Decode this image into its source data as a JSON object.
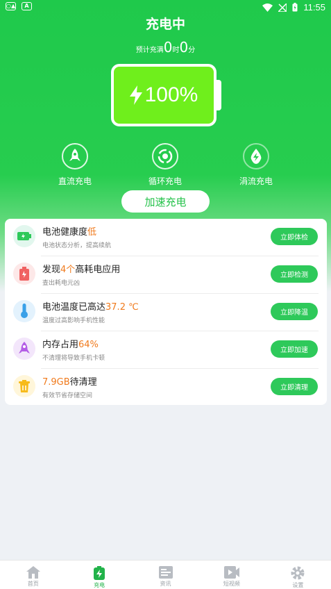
{
  "status_bar": {
    "time": "11:55"
  },
  "header": {
    "title": "充电中",
    "remain_prefix": "预计充满",
    "hours": "0",
    "hours_unit": "时",
    "minutes": "0",
    "minutes_unit": "分"
  },
  "battery": {
    "percent": "100%",
    "level": 1.0
  },
  "modes": [
    {
      "label": "直流充电",
      "icon": "rocket-icon"
    },
    {
      "label": "循环充电",
      "icon": "cycle-icon"
    },
    {
      "label": "涓流充电",
      "icon": "drop-bolt-icon"
    }
  ],
  "boost_label": "加速充电",
  "items": [
    {
      "title_before": "电池健康度",
      "title_highlight": "低",
      "title_after": "",
      "subtitle": "电池状态分析，提高续航",
      "button": "立即体检",
      "icon": "battery-icon",
      "icon_bg": "#e2f7ee",
      "icon_color": "#2ec95a"
    },
    {
      "title_before": "发现",
      "title_highlight": "4个",
      "title_after": "高耗电应用",
      "subtitle": "查出耗电元凶",
      "button": "立即检测",
      "icon": "battery-warning-icon",
      "icon_bg": "#fde8e8",
      "icon_color": "#f06262"
    },
    {
      "title_before": "电池温度已高达",
      "title_highlight": "37.2 ℃",
      "title_after": "",
      "subtitle": "温度过高影响手机性能",
      "button": "立即降温",
      "icon": "thermometer-icon",
      "icon_bg": "#e3f2fd",
      "icon_color": "#3aa0e8"
    },
    {
      "title_before": "内存占用",
      "title_highlight": "64%",
      "title_after": "",
      "subtitle": "不清理将导致手机卡顿",
      "button": "立即加速",
      "icon": "rocket-icon",
      "icon_bg": "#f3e6fb",
      "icon_color": "#b45de6"
    },
    {
      "title_before": "",
      "title_highlight": "7.9GB",
      "title_after": "待清理",
      "subtitle": "有效节省存储空间",
      "button": "立即清理",
      "icon": "trash-icon",
      "icon_bg": "#fff6da",
      "icon_color": "#f7bb1b"
    }
  ],
  "tabs": [
    {
      "label": "首页",
      "icon": "home-icon"
    },
    {
      "label": "充电",
      "icon": "charge-icon"
    },
    {
      "label": "资讯",
      "icon": "news-icon"
    },
    {
      "label": "短视频",
      "icon": "video-icon"
    },
    {
      "label": "设置",
      "icon": "gear-icon"
    }
  ],
  "colors": {
    "primary": "#1fc94b",
    "accent": "#f07a1c",
    "battery_fill": "#6fef1c"
  }
}
